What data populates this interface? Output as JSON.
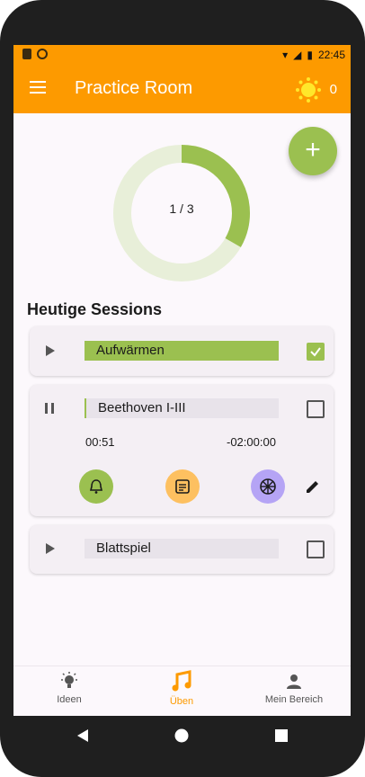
{
  "status": {
    "time": "22:45"
  },
  "appbar": {
    "title": "Practice Room",
    "sun_count": "0"
  },
  "progress": {
    "label": "1 / 3",
    "fraction": 0.333
  },
  "section_title": "Heutige Sessions",
  "sessions": [
    {
      "name": "Aufwärmen",
      "checked": true,
      "state": "play"
    },
    {
      "name": "Beethoven I-III",
      "checked": false,
      "state": "pause",
      "elapsed": "00:51",
      "remaining": "-02:00:00"
    },
    {
      "name": "Blattspiel",
      "checked": false,
      "state": "play"
    }
  ],
  "tools": [
    {
      "icon": "bell-icon",
      "color": "#9bc050"
    },
    {
      "icon": "note-icon",
      "color": "#fdc060"
    },
    {
      "icon": "wheel-icon",
      "color": "#b5a4f5"
    }
  ],
  "nav": [
    {
      "label": "Ideen",
      "icon": "lightbulb-icon",
      "active": false
    },
    {
      "label": "Üben",
      "icon": "music-note-icon",
      "active": true
    },
    {
      "label": "Mein Bereich",
      "icon": "person-icon",
      "active": false
    }
  ],
  "colors": {
    "accent": "#fd9a00",
    "green": "#9bc050"
  }
}
